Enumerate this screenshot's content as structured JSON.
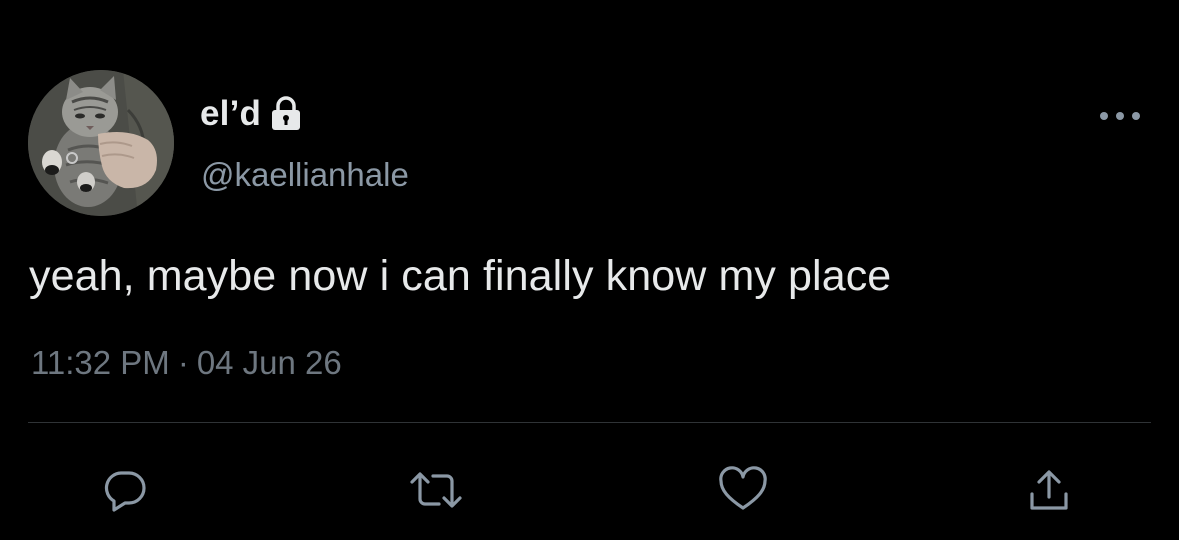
{
  "tweet": {
    "author": {
      "display_name": "el’d",
      "handle": "@kaellianhale",
      "avatar_icon": "cat-avatar-photo",
      "protected_icon": "lock-icon"
    },
    "menu_icon": "more-options-icon",
    "text": "yeah, maybe now i can finally know my place",
    "time": "11:32 PM",
    "separator": "·",
    "date": "04 Jun 26",
    "actions": {
      "reply_icon": "reply-icon",
      "retweet_icon": "retweet-icon",
      "like_icon": "heart-icon",
      "share_icon": "share-icon"
    }
  },
  "colors": {
    "background": "#000000",
    "primary_text": "#e7e9ea",
    "secondary_text": "#8b98a5",
    "meta_text": "#6e7780",
    "icon": "#8b98a5",
    "divider": "#2f3336"
  }
}
